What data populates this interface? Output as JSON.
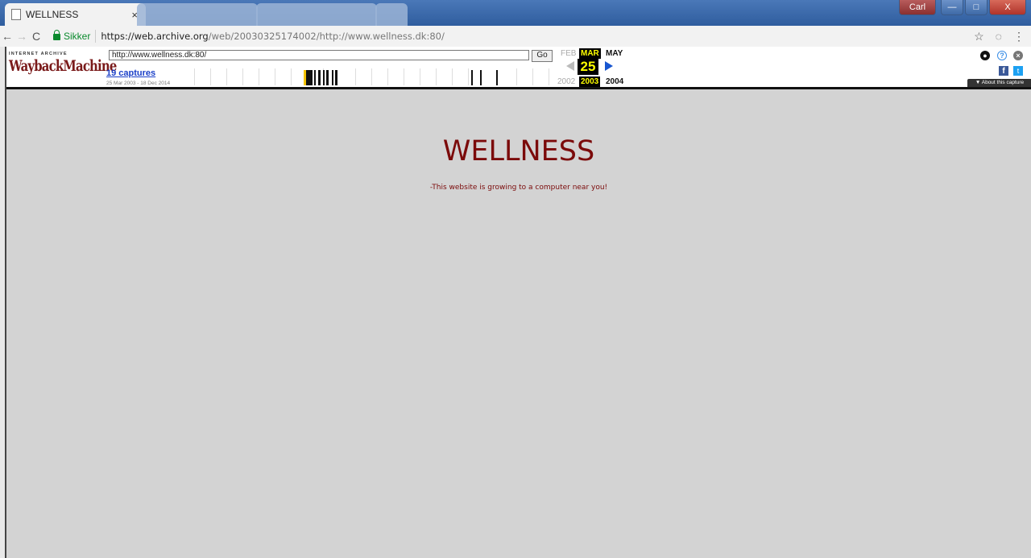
{
  "browser": {
    "tab_title": "WELLNESS",
    "tab_close": "×",
    "win_user": "Carl",
    "win_min": "—",
    "win_max": "□",
    "win_close": "X",
    "back": "←",
    "forward": "→",
    "reload": "C",
    "secure_label": "Sikker",
    "url_host": "https://web.archive.org",
    "url_path": "/web/20030325174002/http://www.wellness.dk:80/",
    "star": "☆",
    "ext": "◌",
    "menu": "⋮"
  },
  "wayback": {
    "logo_top": "INTERNET ARCHIVE",
    "logo_main": "WaybackMachine",
    "url_value": "http://www.wellness.dk:80/",
    "go_label": "Go",
    "captures_label": "19 captures",
    "date_range": "25 Mar 2003 - 18 Dec 2014",
    "month_prev": "FEB",
    "month_cur": "MAR",
    "month_next": "MAY",
    "day": "25",
    "year_prev": "2002",
    "year_cur": "2003",
    "year_next": "2004",
    "fb": "f",
    "tw": "t",
    "about_label": "▼ About this capture"
  },
  "page": {
    "title": "WELLNESS",
    "tagline": "-This website is growing to a computer near you!"
  },
  "colors": {
    "page_bg": "#d3d3d3",
    "title_color": "#7b0a0a"
  }
}
